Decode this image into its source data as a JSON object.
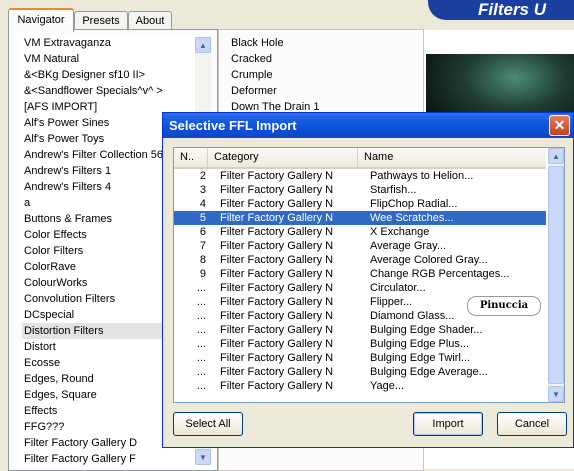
{
  "app": {
    "banner_text": "Filters U"
  },
  "tabs": [
    "Navigator",
    "Presets",
    "About"
  ],
  "left_list": {
    "items": [
      "VM Extravaganza",
      "VM Natural",
      "&<BKg Designer sf10 II>",
      "&<Sandflower Specials^v^ >",
      "[AFS IMPORT]",
      "Alf's Power Sines",
      "Alf's Power Toys",
      "Andrew's Filter Collection 56",
      "Andrew's Filters 1",
      "Andrew's Filters 4",
      "a",
      "Buttons & Frames",
      "Color Effects",
      "Color Filters",
      "ColorRave",
      "ColourWorks",
      "Convolution Filters",
      "DCspecial",
      "Distortion Filters",
      "Distort",
      "Ecosse",
      "Edges, Round",
      "Edges, Square",
      "Effects",
      "FFG???",
      "Filter Factory Gallery D",
      "Filter Factory Gallery F"
    ],
    "selected": "Distortion Filters"
  },
  "mid_list": {
    "items": [
      "Black Hole",
      "Cracked",
      "Crumple",
      "Deformer",
      "Down The Drain 1"
    ]
  },
  "dialog": {
    "title": "Selective FFL Import",
    "columns": {
      "no": "N..",
      "category": "Category",
      "name": "Name"
    },
    "rows": [
      {
        "no": "2",
        "category": "Filter Factory Gallery N",
        "name": "Pathways to Helion..."
      },
      {
        "no": "3",
        "category": "Filter Factory Gallery N",
        "name": "Starfish..."
      },
      {
        "no": "4",
        "category": "Filter Factory Gallery N",
        "name": "FlipChop Radial..."
      },
      {
        "no": "5",
        "category": "Filter Factory Gallery N",
        "name": "Wee Scratches..."
      },
      {
        "no": "6",
        "category": "Filter Factory Gallery N",
        "name": "X Exchange"
      },
      {
        "no": "7",
        "category": "Filter Factory Gallery N",
        "name": "Average Gray..."
      },
      {
        "no": "8",
        "category": "Filter Factory Gallery N",
        "name": "Average Colored Gray..."
      },
      {
        "no": "9",
        "category": "Filter Factory Gallery N",
        "name": "Change RGB Percentages..."
      },
      {
        "no": "...",
        "category": "Filter Factory Gallery N",
        "name": "Circulator..."
      },
      {
        "no": "...",
        "category": "Filter Factory Gallery N",
        "name": "Flipper..."
      },
      {
        "no": "...",
        "category": "Filter Factory Gallery N",
        "name": "Diamond Glass..."
      },
      {
        "no": "...",
        "category": "Filter Factory Gallery N",
        "name": "Bulging Edge Shader..."
      },
      {
        "no": "...",
        "category": "Filter Factory Gallery N",
        "name": "Bulging Edge Plus..."
      },
      {
        "no": "...",
        "category": "Filter Factory Gallery N",
        "name": "Bulging Edge Twirl..."
      },
      {
        "no": "...",
        "category": "Filter Factory Gallery N",
        "name": "Bulging Edge Average..."
      },
      {
        "no": "...",
        "category": "Filter Factory Gallery N",
        "name": "Yage..."
      }
    ],
    "selected_row": "Wee Scratches...",
    "watermark": "Pinuccia",
    "buttons": {
      "select_all": "Select All",
      "import": "Import",
      "cancel": "Cancel"
    }
  },
  "colors": {
    "title_bar": "#0f55e0",
    "selection": "#316ac5",
    "banner": "#1b3f9e",
    "close_button": "#c8401a"
  }
}
